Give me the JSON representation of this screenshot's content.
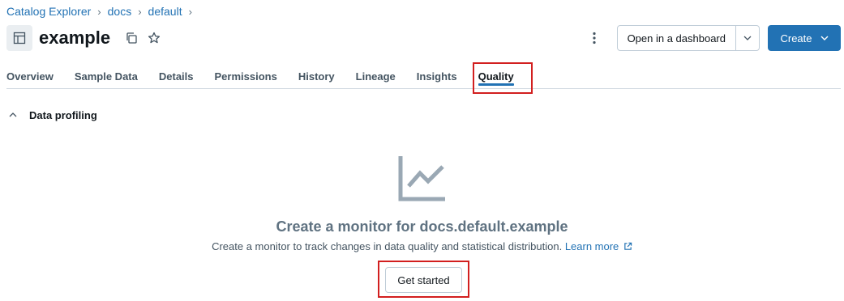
{
  "breadcrumb": {
    "items": [
      "Catalog Explorer",
      "docs",
      "default"
    ],
    "separator": "›"
  },
  "header": {
    "title": "example",
    "icons": [
      "table-icon",
      "copy-icon",
      "star-icon",
      "kebab-menu-icon"
    ],
    "open_dashboard_label": "Open in a dashboard",
    "create_label": "Create"
  },
  "tabs": [
    {
      "label": "Overview",
      "active": false
    },
    {
      "label": "Sample Data",
      "active": false
    },
    {
      "label": "Details",
      "active": false
    },
    {
      "label": "Permissions",
      "active": false
    },
    {
      "label": "History",
      "active": false
    },
    {
      "label": "Lineage",
      "active": false
    },
    {
      "label": "Insights",
      "active": false
    },
    {
      "label": "Quality",
      "active": true
    }
  ],
  "section": {
    "label": "Data profiling",
    "expanded": true
  },
  "empty_state": {
    "icon": "line-chart-icon",
    "title": "Create a monitor for docs.default.example",
    "description": "Create a monitor to track changes in data quality and statistical distribution.",
    "learn_more_label": "Learn more",
    "button_label": "Get started"
  },
  "colors": {
    "accent": "#2272b4",
    "highlight": "#d21f1f"
  }
}
